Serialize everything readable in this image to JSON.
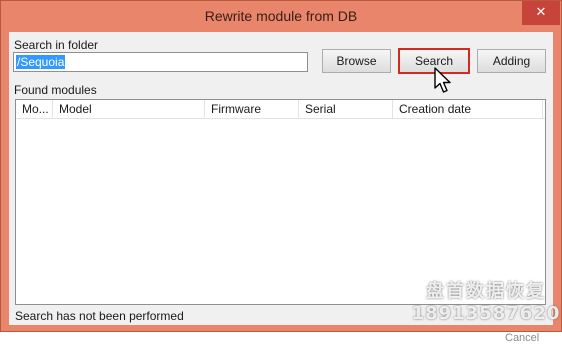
{
  "window": {
    "title": "Rewrite module from DB",
    "close_glyph": "✕"
  },
  "search_folder": {
    "label": "Search in folder",
    "value": "/Sequoia"
  },
  "buttons": {
    "browse": "Browse",
    "search": "Search",
    "adding": "Adding",
    "cancel": "Cancel"
  },
  "found_modules": {
    "label": "Found modules",
    "columns": [
      "Mo...",
      "Model",
      "Firmware",
      "Serial",
      "Creation date"
    ],
    "rows": []
  },
  "status": "Search has not been performed",
  "watermark": {
    "line1": "盘首数据恢复",
    "line2": "18913587620"
  },
  "colors": {
    "frame": "#e8856a",
    "close_button": "#c7443a",
    "focus_outline": "#d22a20",
    "selection": "#3399ff"
  },
  "icons": {
    "cursor": "mouse-pointer-icon",
    "close": "close-icon"
  }
}
